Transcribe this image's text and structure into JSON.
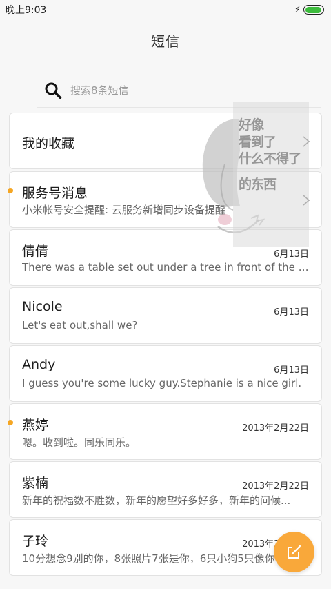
{
  "status_bar": {
    "time": "晚上9:03",
    "battery_icon": "battery-charging-icon",
    "battery_level": 0.95
  },
  "header": {
    "title": "短信"
  },
  "search": {
    "placeholder": "搜索8条短信",
    "icon": "search-icon"
  },
  "favorites": {
    "label": "我的收藏"
  },
  "service": {
    "title": "服务号消息",
    "preview": "小米帐号安全提醒: 云服务新增同步设备提醒",
    "unread": true
  },
  "conversations": [
    {
      "name": "倩倩",
      "date": "6月13日",
      "preview": "There was a table set out under a tree in front of the ho...",
      "unread": false
    },
    {
      "name": "Nicole",
      "date": "6月13日",
      "preview": "Let's eat out,shall we?",
      "unread": false
    },
    {
      "name": "Andy",
      "date": "6月13日",
      "preview": "I guess you're some lucky guy.Stephanie is a nice girl.",
      "unread": false
    },
    {
      "name": "燕婷",
      "date": "2013年2月22日",
      "preview": "嗯。收到啦。同乐同乐。",
      "unread": true
    },
    {
      "name": "紫楠",
      "date": "2013年2月22日",
      "preview": "新年的祝福数不胜数，新年的愿望好多好多，新年的问候...",
      "unread": false
    },
    {
      "name": "子玲",
      "date": "2013年2月22日",
      "preview": "10分想念9别的你，8张照片7张是你，6只小狗5只像你",
      "unread": false
    }
  ],
  "watermark": {
    "lines": [
      "好像",
      "看到了",
      "什么不得了",
      "的东西"
    ]
  },
  "fab": {
    "icon": "compose-icon"
  },
  "colors": {
    "accent": "#f9a83a",
    "unread_dot": "#f5a623",
    "battery": "#3dbb3d"
  }
}
